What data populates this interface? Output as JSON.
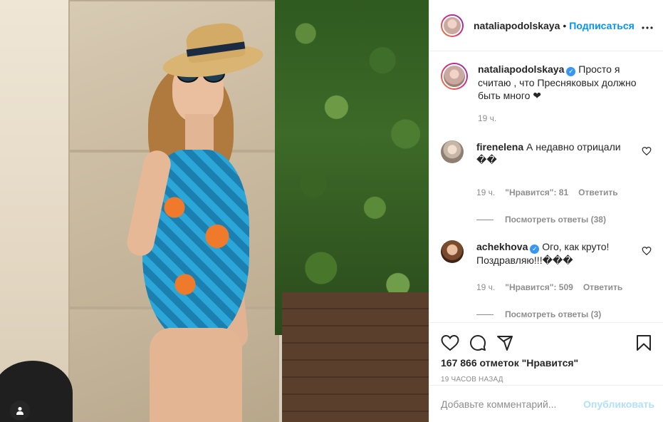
{
  "post": {
    "username": "nataliapodolskaya",
    "follow_label": "Подписаться",
    "header_dot": "•",
    "more_icon": "more-horizontal-icon",
    "caption": {
      "username": "nataliapodolskaya",
      "text": "Просто я считаю , что Пресняковых должно быть много ❤",
      "time": "19 ч."
    },
    "comments": [
      {
        "username": "firenelena",
        "text": "А недавно отрицали ��",
        "time": "19 ч.",
        "likes": "\"Нравится\": 81",
        "reply_label": "Ответить",
        "view_replies": "Посмотреть ответы (38)"
      },
      {
        "username": "achekhova",
        "verified": true,
        "text": "Ого, как круто! Поздравляю!!!���",
        "time": "19 ч.",
        "likes": "\"Нравится\": 509",
        "reply_label": "Ответить",
        "view_replies": "Посмотреть ответы (3)"
      }
    ],
    "likes_count": "167 866 отметок \"Нравится\"",
    "posted_ago": "19 часов назад",
    "comment_placeholder": "Добавьте комментарий...",
    "publish_label": "Опубликовать",
    "colors": {
      "accent": "#0095f6",
      "publish_disabled": "#b2dffc",
      "verified": "#3897f0",
      "muted": "#8e8e8e"
    }
  }
}
